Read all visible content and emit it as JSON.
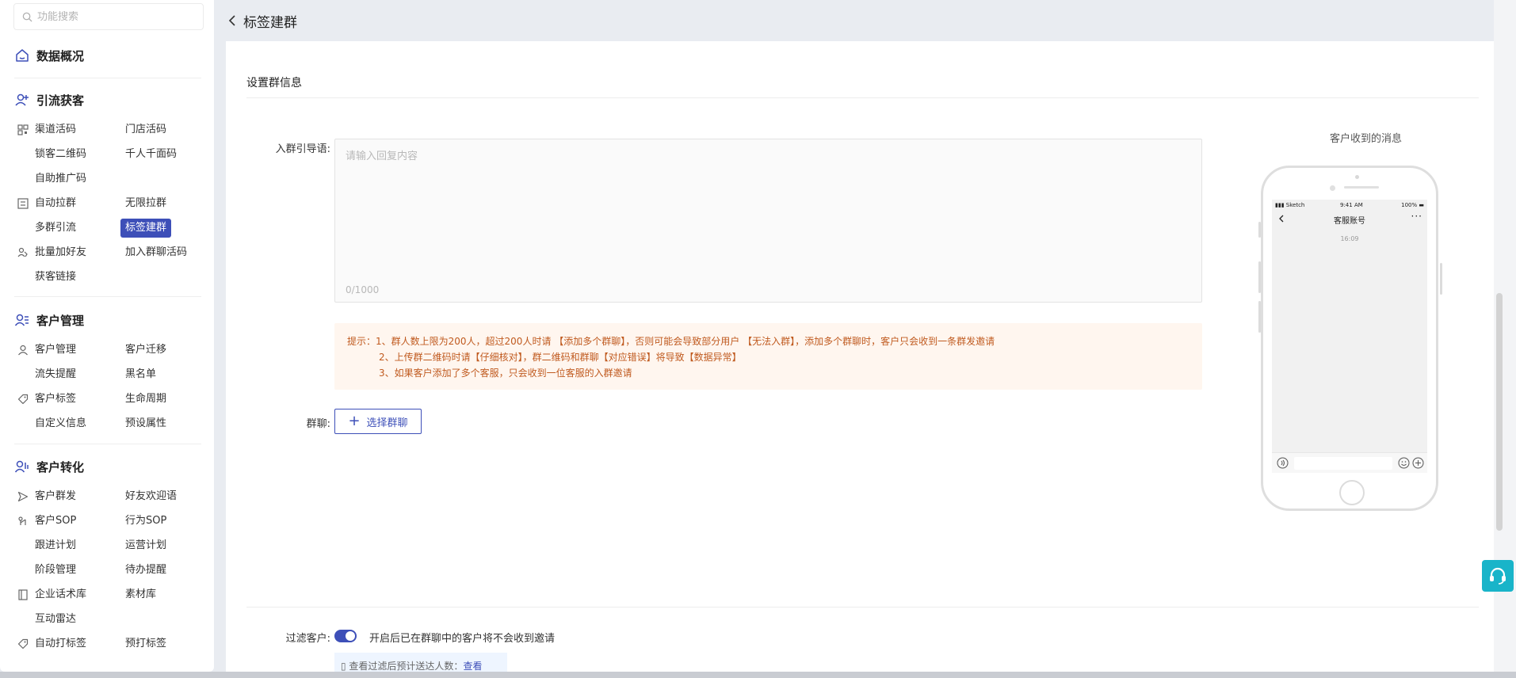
{
  "search": {
    "placeholder": "功能搜索"
  },
  "sidebar": {
    "overview": {
      "label": "数据概况",
      "icon": "dashboard-icon"
    },
    "acquire": {
      "title": "引流获客",
      "rows": [
        {
          "icon": "qr-icon",
          "c1": "渠道活码",
          "c2": "门店活码"
        },
        {
          "icon": "",
          "c1": "锁客二维码",
          "c2": "千人千面码"
        },
        {
          "icon": "",
          "c1": "自助推广码",
          "c2": ""
        },
        {
          "icon": "group-pull-icon",
          "c1": "自动拉群",
          "c2": "无限拉群"
        },
        {
          "icon": "",
          "c1": "多群引流",
          "c2": "标签建群"
        },
        {
          "icon": "batch-add-icon",
          "c1": "批量加好友",
          "c2": "加入群聊活码"
        },
        {
          "icon": "",
          "c1": "获客链接",
          "c2": ""
        }
      ]
    },
    "customer": {
      "title": "客户管理",
      "rows": [
        {
          "icon": "person-icon",
          "c1": "客户管理",
          "c2": "客户迁移"
        },
        {
          "icon": "",
          "c1": "流失提醒",
          "c2": "黑名单"
        },
        {
          "icon": "tag-icon",
          "c1": "客户标签",
          "c2": "生命周期"
        },
        {
          "icon": "",
          "c1": "自定义信息",
          "c2": "预设属性"
        }
      ]
    },
    "convert": {
      "title": "客户转化",
      "rows": [
        {
          "icon": "send-icon",
          "c1": "客户群发",
          "c2": "好友欢迎语"
        },
        {
          "icon": "sop-icon",
          "c1": "客户SOP",
          "c2": "行为SOP"
        },
        {
          "icon": "",
          "c1": "跟进计划",
          "c2": "运营计划"
        },
        {
          "icon": "",
          "c1": "阶段管理",
          "c2": "待办提醒"
        },
        {
          "icon": "book-icon",
          "c1": "企业话术库",
          "c2": "素材库"
        },
        {
          "icon": "",
          "c1": "互动雷达",
          "c2": ""
        },
        {
          "icon": "tag-icon",
          "c1": "自动打标签",
          "c2": "预打标签"
        }
      ]
    }
  },
  "page": {
    "title": "标签建群"
  },
  "form": {
    "section_title": "设置群信息",
    "guide_label": "入群引导语:",
    "guide_placeholder": "请输入回复内容",
    "guide_count": "0/1000",
    "tips": {
      "line1": "提示：1、群人数上限为200人，超过200人时请 【添加多个群聊】，否则可能会导致部分用户 【无法入群】，添加多个群聊时，客户只会收到一条群发邀请",
      "line2": "2、上传群二维码时请【仔细核对】，群二维码和群聊【对应错误】将导致【数据异常】",
      "line3": "3、如果客户添加了多个客服，只会收到一位客服的入群邀请"
    },
    "group_label": "群聊:",
    "select_group_btn": "选择群聊",
    "filter_label": "过滤客户:",
    "filter_toggle_text": "开启后已在群聊中的客户将不会收到邀请",
    "filter_preview_text": "查看过滤后预计送达人数：",
    "filter_preview_link": "查看"
  },
  "preview": {
    "caption": "客户收到的消息",
    "status_left": "Sketch",
    "status_time": "9:41 AM",
    "status_right": "100%",
    "chat_name": "客服账号",
    "chat_more": "···",
    "chat_time": "16:09"
  },
  "colors": {
    "accent": "#3d4fb8",
    "tip_bg": "#fff6ef",
    "tip_text": "#c05a1f",
    "support": "#19b4c9"
  }
}
